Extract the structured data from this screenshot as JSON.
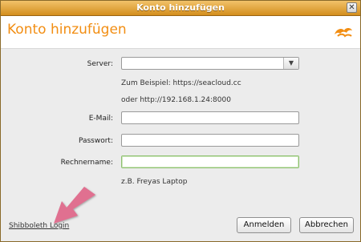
{
  "window": {
    "title": "Konto hinzufügen",
    "close_glyph": "✕"
  },
  "header": {
    "heading": "Konto hinzufügen",
    "logo_icon": "seafile-logo-icon"
  },
  "form": {
    "server_label": "Server:",
    "server_value": "",
    "server_dropdown_glyph": "▼",
    "hint_line1": "Zum Beispiel: https://seacloud.cc",
    "hint_line2": "oder http://192.168.1.24:8000",
    "email_label": "E-Mail:",
    "email_value": "",
    "password_label": "Passwort:",
    "password_value": "",
    "computer_label": "Rechnername:",
    "computer_value": "",
    "computer_hint": "z.B. Freyas Laptop"
  },
  "footer": {
    "shibboleth_link": "Shibboleth Login",
    "login_button": "Anmelden",
    "cancel_button": "Abbrechen"
  },
  "colors": {
    "accent": "#f28e13",
    "titlebar": "#d38e1d",
    "arrow": "#e07090"
  }
}
